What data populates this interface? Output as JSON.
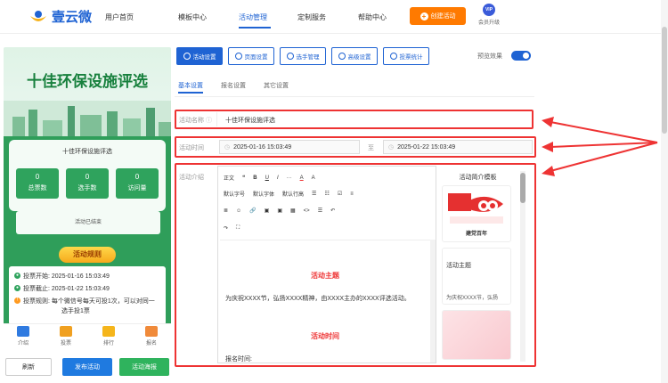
{
  "nav": {
    "brand": "壹云微",
    "items": [
      "用户首页",
      "模板中心",
      "活动管理",
      "定制服务",
      "帮助中心"
    ],
    "create_label": "创建活动",
    "vip_badge": "VIP",
    "vip_label": "会员升级",
    "accent": "#1f63d3",
    "create_color": "#ff7a00"
  },
  "preview": {
    "title": "十佳环保设施评选",
    "card_title": "十佳环保设施评选",
    "stats": [
      {
        "value": "0",
        "label": "总票数"
      },
      {
        "value": "0",
        "label": "选手数"
      },
      {
        "value": "0",
        "label": "访问量"
      }
    ],
    "ended": "活动已结束",
    "rules_head": "活动规则",
    "rules": [
      "投票开始: 2025-01-16 15:03:49",
      "投票截止: 2025-01-22 15:03:49",
      "投票规则: 每个微信号每天可投1次，可以对同一",
      "选手投1票"
    ],
    "tabs": [
      "介绍",
      "投票",
      "排行",
      "报名"
    ]
  },
  "bottom_buttons": {
    "refresh": "刷新",
    "publish": "发布活动",
    "poster": "活动海报"
  },
  "toolbar": {
    "buttons": [
      "活动设置",
      "页面设置",
      "选手管理",
      "高级设置",
      "投票统计"
    ],
    "preview_label": "预览效果"
  },
  "subtabs": [
    "基本设置",
    "报名设置",
    "其它设置"
  ],
  "form": {
    "name_label": "活动名称",
    "name_value": "十佳环保设施评选",
    "time_label": "活动时间",
    "time_start": "2025-01-16 15:03:49",
    "time_to": "至",
    "time_end": "2025-01-22 15:03:49",
    "intro_label": "活动介绍"
  },
  "editor": {
    "toolbar_row1": [
      "正文",
      "❝",
      "B",
      "U",
      "I",
      "···",
      "A",
      "A"
    ],
    "toolbar_row2": [
      "默认字号",
      "默认字体",
      "默认行高",
      "☰",
      "☷",
      "☑",
      "≡"
    ],
    "toolbar_row3": [
      "≣",
      "☺",
      "🔗",
      "▣",
      "▣",
      "▦",
      "<>",
      "☰",
      "↶"
    ],
    "toolbar_row4": [
      "↷",
      "⛶"
    ],
    "heading1": "活动主题",
    "paragraph1": "为庆祝XXXX节，弘扬XXXX精神，由XXXX主办的XXXX评选活动。",
    "heading2": "活动时间",
    "paragraph2": "报名时间:"
  },
  "templates": {
    "title": "活动简介模板",
    "card1_text": "建党百年",
    "card2_text": "活动主题",
    "card2_sub": "为庆祝XXXX节，弘扬"
  }
}
